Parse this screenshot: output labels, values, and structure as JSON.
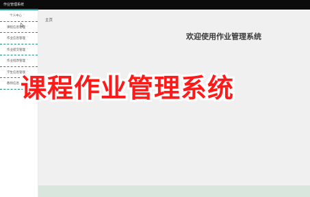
{
  "window": {
    "title": "作业管理系统"
  },
  "sidebar": {
    "items": [
      {
        "label": "个人中心",
        "icon": "chevron-down-icon"
      },
      {
        "label": "课程信息管理",
        "icon": "chevron-down-icon"
      },
      {
        "label": "作业信息管理",
        "icon": "chevron-down-icon"
      },
      {
        "label": "作业提交管理",
        "icon": "chevron-down-icon"
      },
      {
        "label": "作业批改管理",
        "icon": "chevron-down-icon"
      },
      {
        "label": "学生信息管理",
        "icon": "chevron-down-icon"
      },
      {
        "label": "教师信息管理",
        "icon": "chevron-down-icon"
      }
    ]
  },
  "main": {
    "tab": "主页",
    "welcome": "欢迎使用作业管理系统"
  },
  "overlay": {
    "title": "课程作业管理系统"
  },
  "colors": {
    "topbar": "#0b0b0b",
    "accent": "#1e8a7c",
    "main_bg": "#f0f0f0",
    "overlay_text": "#ff1a1a",
    "bottom_panel": "#d8e6de"
  }
}
